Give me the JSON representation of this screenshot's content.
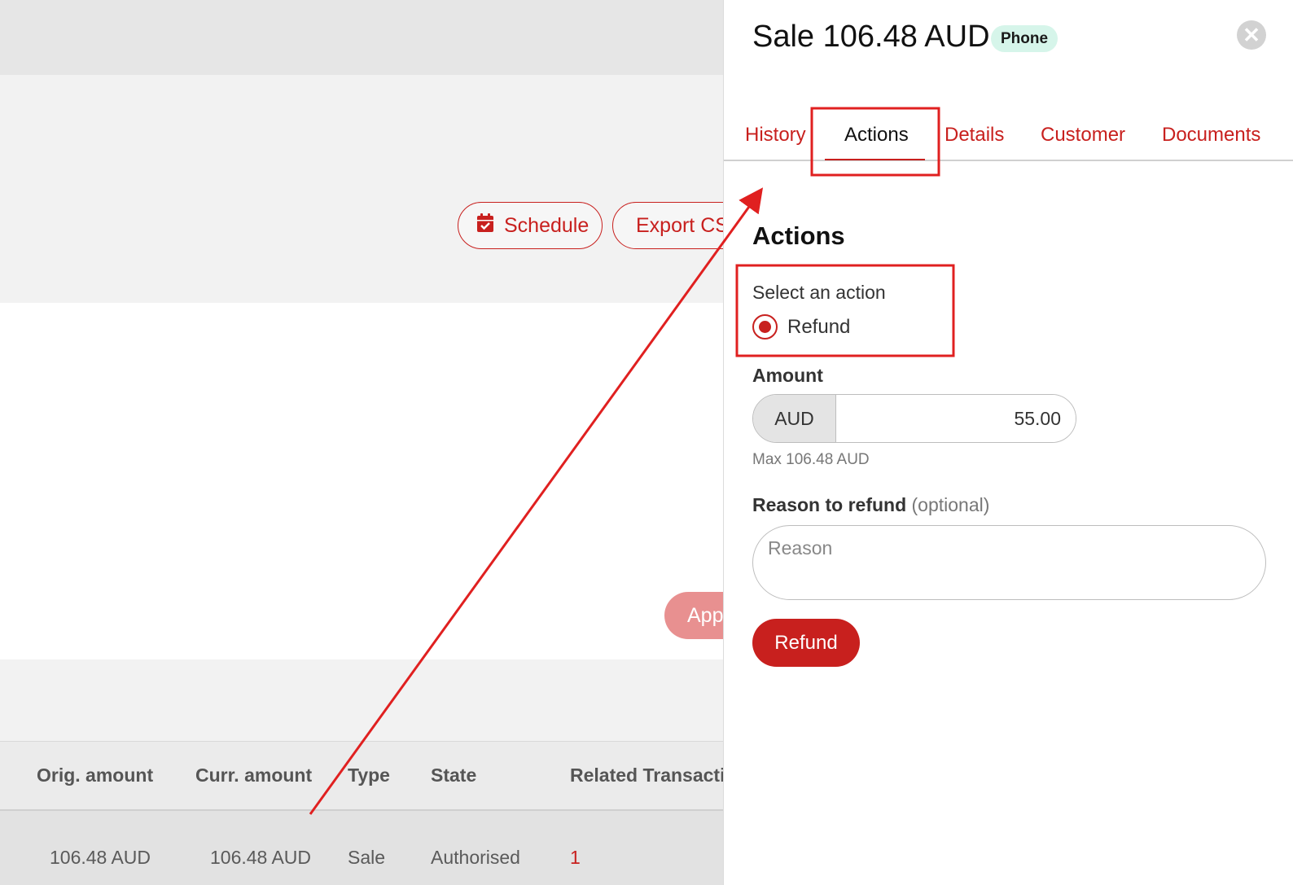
{
  "background": {
    "buttons": {
      "schedule": "Schedule",
      "export_csv": "Export CSV",
      "apply": "Apply"
    },
    "table": {
      "headers": [
        "Orig. amount",
        "Curr. amount",
        "Type",
        "State",
        "Related Transactions"
      ],
      "row": {
        "orig_amount": "106.48 AUD",
        "curr_amount": "106.48 AUD",
        "type": "Sale",
        "state": "Authorised",
        "related": "1"
      }
    }
  },
  "panel": {
    "title": "Sale 106.48 AUD",
    "badge": "Phone",
    "close_icon": "close-icon",
    "tabs": [
      "History",
      "Actions",
      "Details",
      "Customer",
      "Documents"
    ],
    "active_tab": "Actions",
    "section_heading": "Actions",
    "select_action_label": "Select an action",
    "radio_option": "Refund",
    "radio_selected": true,
    "amount_label": "Amount",
    "currency": "AUD",
    "amount_value": "55.00",
    "max_hint": "Max 106.48 AUD",
    "reason_label": "Reason to refund",
    "reason_optional": "(optional)",
    "reason_placeholder": "Reason",
    "submit_label": "Refund"
  },
  "colors": {
    "accent": "#c8201e",
    "badge_bg": "#d6f5ea",
    "annotation": "#e02020"
  }
}
